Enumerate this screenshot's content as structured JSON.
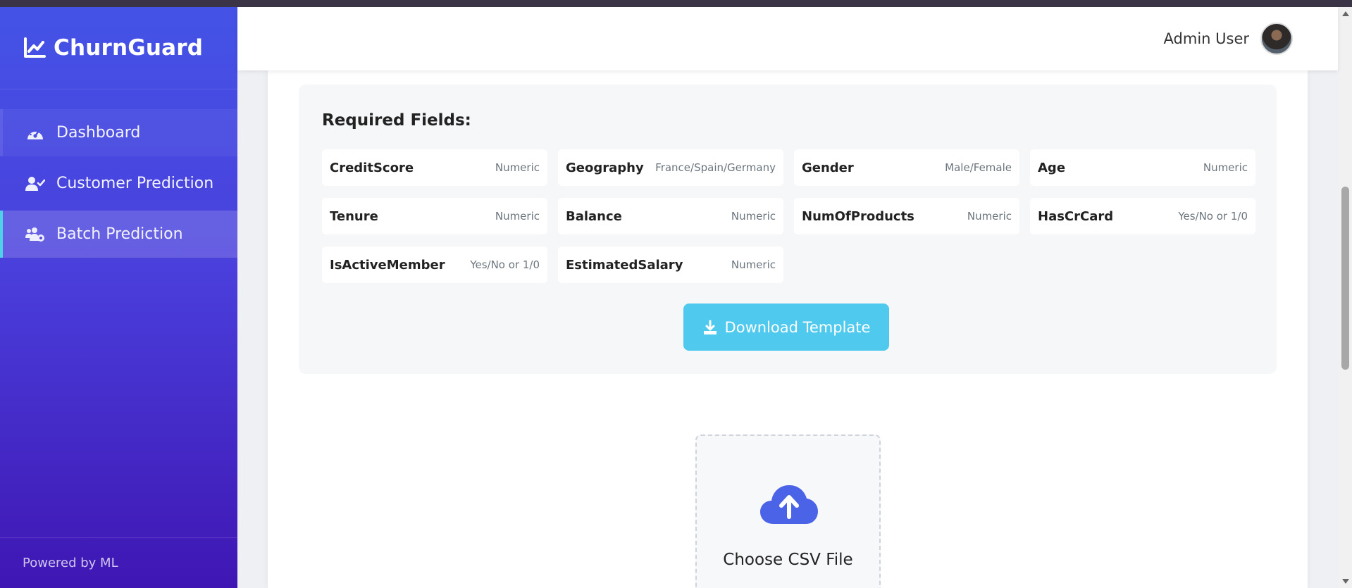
{
  "app": {
    "name": "ChurnGuard",
    "footer": "Powered by ML",
    "accent": "#4fd1e8"
  },
  "sidebar": {
    "items": [
      {
        "label": "Dashboard",
        "icon": "tachometer-icon",
        "active": false
      },
      {
        "label": "Customer Prediction",
        "icon": "user-check-icon",
        "active": false
      },
      {
        "label": "Batch Prediction",
        "icon": "users-cog-icon",
        "active": true
      }
    ]
  },
  "header": {
    "user_name": "Admin User"
  },
  "required": {
    "title": "Required Fields:",
    "fields": [
      {
        "name": "CreditScore",
        "type": "Numeric"
      },
      {
        "name": "Geography",
        "type": "France/Spain/Germany"
      },
      {
        "name": "Gender",
        "type": "Male/Female"
      },
      {
        "name": "Age",
        "type": "Numeric"
      },
      {
        "name": "Tenure",
        "type": "Numeric"
      },
      {
        "name": "Balance",
        "type": "Numeric"
      },
      {
        "name": "NumOfProducts",
        "type": "Numeric"
      },
      {
        "name": "HasCrCard",
        "type": "Yes/No or 1/0"
      },
      {
        "name": "IsActiveMember",
        "type": "Yes/No or 1/0"
      },
      {
        "name": "EstimatedSalary",
        "type": "Numeric"
      }
    ],
    "download_label": "Download Template",
    "download_color": "#4fc9ee"
  },
  "upload": {
    "label": "Choose CSV File",
    "icon": "cloud-upload-icon",
    "icon_color": "#4a63e7"
  }
}
